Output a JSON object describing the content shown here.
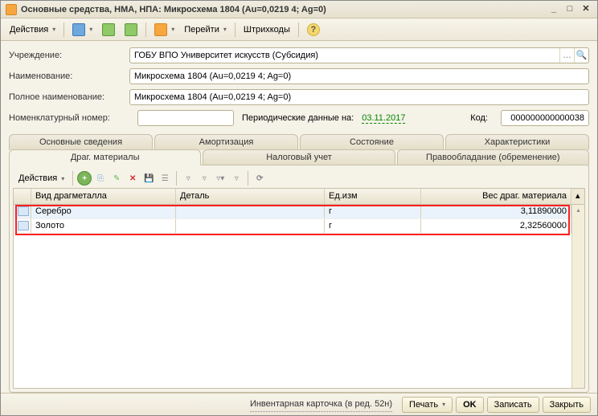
{
  "window": {
    "title": "Основные средства, НМА, НПА: Микросхема 1804 (Au=0,0219 4; Ag=0)"
  },
  "toolbar": {
    "actions": "Действия",
    "go": "Перейти",
    "barcodes": "Штрихкоды"
  },
  "form": {
    "org_label": "Учреждение:",
    "org_value": "ГОБУ ВПО Университет искусств (Субсидия)",
    "name_label": "Наименование:",
    "name_value": "Микросхема 1804 (Au=0,0219 4; Ag=0)",
    "fullname_label": "Полное наименование:",
    "fullname_value": "Микросхема 1804 (Au=0,0219 4; Ag=0)",
    "nomenk_label": "Номенклатурный номер:",
    "nomenk_value": "",
    "periodic_label": "Периодические данные на:",
    "periodic_value": "03.11.2017",
    "code_label": "Код:",
    "code_value": "000000000000038"
  },
  "tabs": {
    "row1": [
      "Основные сведения",
      "Амортизация",
      "Состояние",
      "Характеристики"
    ],
    "row2": [
      "Драг. материалы",
      "Налоговый учет",
      "Правообладание (обременение)"
    ]
  },
  "grid_toolbar": {
    "actions": "Действия"
  },
  "grid": {
    "headers": {
      "type": "Вид драгметалла",
      "detail": "Деталь",
      "unit": "Ед.изм",
      "weight": "Вес драг. материала"
    },
    "rows": [
      {
        "type": "Серебро",
        "detail": "",
        "unit": "г",
        "weight": "3,11890000"
      },
      {
        "type": "Золото",
        "detail": "",
        "unit": "г",
        "weight": "2,32560000"
      }
    ]
  },
  "footer": {
    "inv": "Инвентарная карточка (в ред. 52н)",
    "print": "Печать",
    "ok": "OK",
    "save": "Записать",
    "close": "Закрыть"
  }
}
